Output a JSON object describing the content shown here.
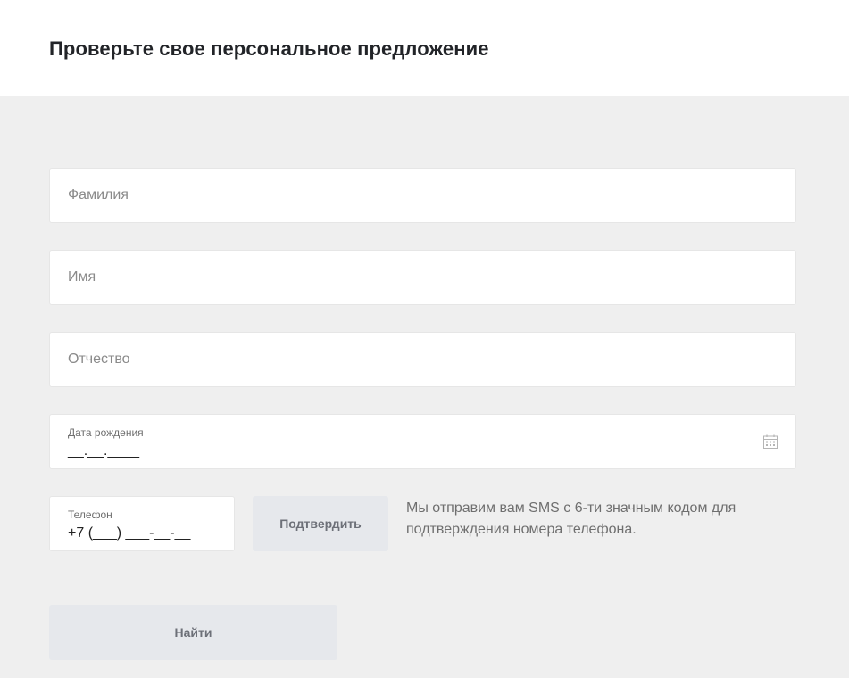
{
  "header": {
    "title": "Проверьте свое персональное предложение"
  },
  "form": {
    "last_name": {
      "placeholder": "Фамилия",
      "value": ""
    },
    "first_name": {
      "placeholder": "Имя",
      "value": ""
    },
    "middle_name": {
      "placeholder": "Отчество",
      "value": ""
    },
    "birth_date": {
      "label": "Дата рождения",
      "value": "__.__.____",
      "icon": "calendar-icon"
    },
    "phone": {
      "label": "Телефон",
      "value": "+7 (___) ___-__-__"
    },
    "confirm_label": "Подтвердить",
    "sms_note": "Мы отправим вам SMS с 6-ти значным кодом для подтверждения номера телефона.",
    "find_label": "Найти"
  },
  "colors": {
    "background": "#efefef",
    "header_bg": "#ffffff",
    "button_bg": "#e6e8ec",
    "button_text": "#6d7078"
  }
}
